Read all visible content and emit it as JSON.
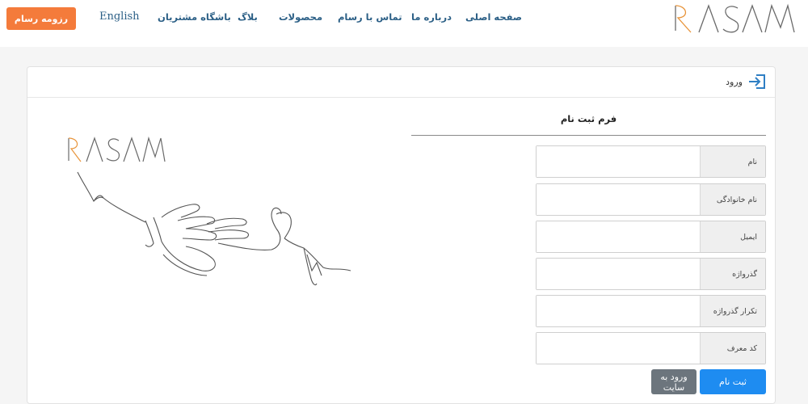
{
  "header": {
    "resume_button": "رزومه رسام",
    "nav": [
      {
        "label": "English"
      },
      {
        "label": "باشگاه مشتریان"
      },
      {
        "label": "بلاگ"
      },
      {
        "label": "محصولات"
      },
      {
        "label": "تماس با رسام"
      },
      {
        "label": "درباره ما"
      },
      {
        "label": "صفحه اصلی"
      }
    ],
    "logo_text": "RASAM"
  },
  "card": {
    "login_label": "ورود",
    "form_title": "فرم ثبت نام",
    "fields": [
      {
        "label": "نام",
        "value": "",
        "placeholder": ""
      },
      {
        "label": "نام خانوادگی",
        "value": "",
        "placeholder": ""
      },
      {
        "label": "ایمیل",
        "value": "",
        "placeholder": ""
      },
      {
        "label": "گذرواژه",
        "value": "",
        "placeholder": ""
      },
      {
        "label": "تکرار گذرواژه",
        "value": "",
        "placeholder": ""
      },
      {
        "label": "کد معرف",
        "value": "",
        "placeholder": ""
      }
    ],
    "submit_button": "ثبت نام",
    "login_button": "ورود به سایت"
  },
  "illustration": {
    "logo_text": "RASAM"
  },
  "colors": {
    "accent_orange": "#f47b3b",
    "nav_blue": "#2b5f86",
    "primary_blue": "#1e8cf1",
    "secondary_gray": "#6c757d"
  }
}
